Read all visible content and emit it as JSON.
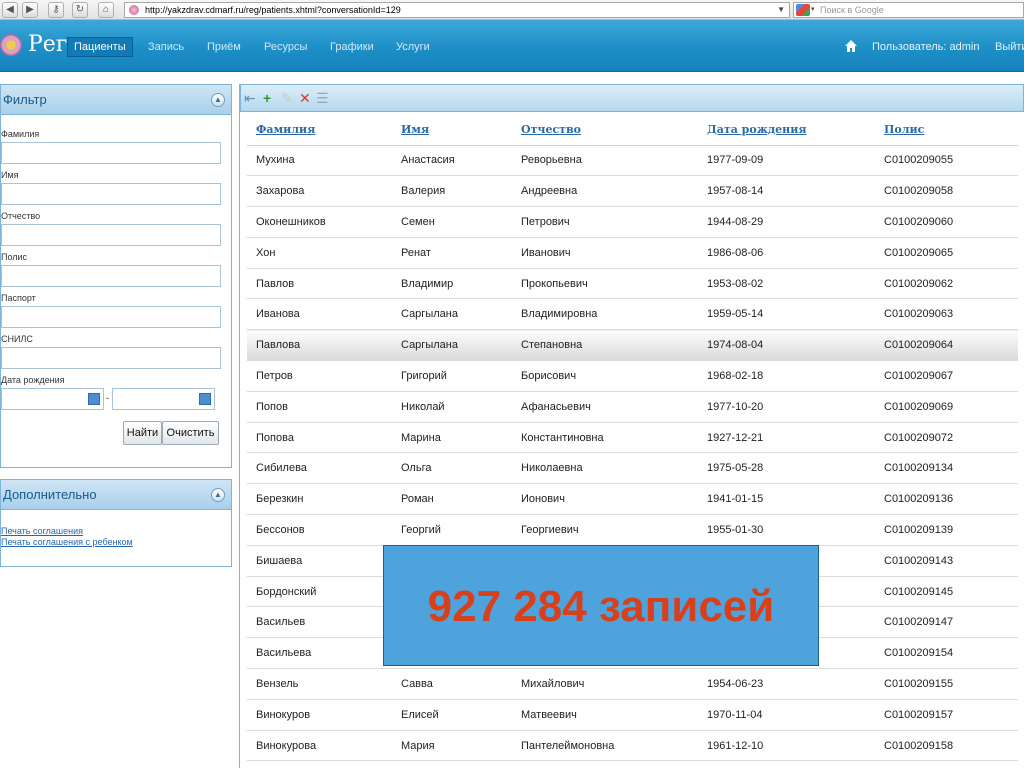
{
  "browser": {
    "url": "http://yakzdrav.cdmarf.ru/reg/patients.xhtml?conversationId=129",
    "search_placeholder": "Поиск в Google"
  },
  "nav": {
    "app_name": "Рег",
    "items": [
      "Пациенты",
      "Запись",
      "Приём",
      "Ресурсы",
      "Графики",
      "Услуги"
    ],
    "active_index": 0,
    "user": "Пользователь: admin",
    "logout": "Выйти"
  },
  "filter": {
    "title": "Фильтр",
    "fields": [
      "Фамилия",
      "Имя",
      "Отчество",
      "Полис",
      "Паспорт",
      "СНИЛС"
    ],
    "dob_label": "Дата рождения",
    "date_sep": "-",
    "find_button": "Найти",
    "clear_button": "Очистить"
  },
  "extra": {
    "title": "Дополнительно",
    "links": [
      "Печать соглашения",
      "Печать соглашения с ребенком"
    ]
  },
  "grid": {
    "columns": [
      "Фамилия",
      "Имя",
      "Отчество",
      "Дата рождения",
      "Полис"
    ],
    "rows": [
      [
        "Мухина",
        "Анастасия",
        "Реворьевна",
        "1977-09-09",
        "С0100209055"
      ],
      [
        "Захарова",
        "Валерия",
        "Андреевна",
        "1957-08-14",
        "С0100209058"
      ],
      [
        "Оконешников",
        "Семен",
        "Петрович",
        "1944-08-29",
        "С0100209060"
      ],
      [
        "Хон",
        "Ренат",
        "Иванович",
        "1986-08-06",
        "С0100209065"
      ],
      [
        "Павлов",
        "Владимир",
        "Прокопьевич",
        "1953-08-02",
        "С0100209062"
      ],
      [
        "Иванова",
        "Саргылана",
        "Владимировна",
        "1959-05-14",
        "С0100209063"
      ],
      [
        "Павлова",
        "Саргылана",
        "Степановна",
        "1974-08-04",
        "С0100209064"
      ],
      [
        "Петров",
        "Григорий",
        "Борисович",
        "1968-02-18",
        "С0100209067"
      ],
      [
        "Попов",
        "Николай",
        "Афанасьевич",
        "1977-10-20",
        "С0100209069"
      ],
      [
        "Попова",
        "Марина",
        "Константиновна",
        "1927-12-21",
        "С0100209072"
      ],
      [
        "Сибилева",
        "Ольга",
        "Николаевна",
        "1975-05-28",
        "С0100209134"
      ],
      [
        "Березкин",
        "Роман",
        "Ионович",
        "1941-01-15",
        "С0100209136"
      ],
      [
        "Бессонов",
        "Георгий",
        "Георгиевич",
        "1955-01-30",
        "С0100209139"
      ],
      [
        "Бишаева",
        "",
        "",
        "",
        "С0100209143"
      ],
      [
        "Бордонский",
        "",
        "",
        "",
        "С0100209145"
      ],
      [
        "Васильев",
        "",
        "",
        "",
        "С0100209147"
      ],
      [
        "Васильева",
        "",
        "",
        "",
        "С0100209154"
      ],
      [
        "Вензель",
        "Савва",
        "Михайлович",
        "1954-06-23",
        "С0100209155"
      ],
      [
        "Винокуров",
        "Елисей",
        "Матвеевич",
        "1970-11-04",
        "С0100209157"
      ],
      [
        "Винокурова",
        "Мария",
        "Пантелеймоновна",
        "1961-12-10",
        "С0100209158"
      ]
    ],
    "selected_row": 6
  },
  "overlay": {
    "text": "927 284 записей"
  },
  "colors": {
    "accent": "#1d8fc7",
    "overlay_bg": "#4fa3dc",
    "overlay_text": "#d6401b"
  }
}
